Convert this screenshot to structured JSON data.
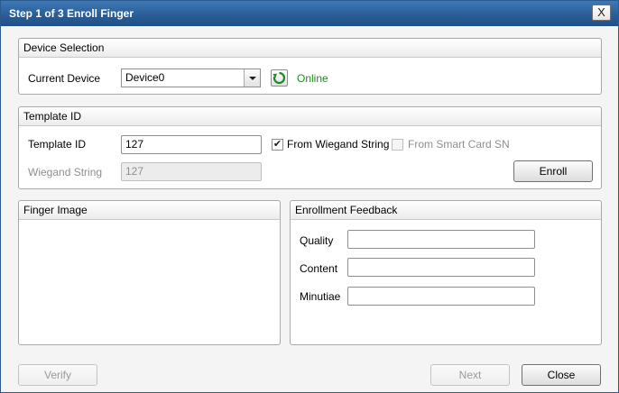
{
  "window": {
    "title": "Step 1 of 3 Enroll Finger",
    "close_glyph": "X"
  },
  "device_selection": {
    "header": "Device Selection",
    "current_device_label": "Current Device",
    "current_device_value": "Device0",
    "status": "Online"
  },
  "template_id": {
    "header": "Template ID",
    "template_id_label": "Template ID",
    "template_id_value": "127",
    "from_wiegand_label": "From Wiegand String",
    "from_wiegand_checked": true,
    "from_smart_card_label": "From Smart Card SN",
    "from_smart_card_checked": false,
    "wiegand_label": "Wiegand String",
    "wiegand_value": "127",
    "enroll_label": "Enroll"
  },
  "finger_image": {
    "header": "Finger Image"
  },
  "enrollment_feedback": {
    "header": "Enrollment Feedback",
    "quality_label": "Quality",
    "quality_value": "",
    "content_label": "Content",
    "content_value": "",
    "minutiae_label": "Minutiae",
    "minutiae_value": ""
  },
  "footer": {
    "verify_label": "Verify",
    "next_label": "Next",
    "close_label": "Close"
  },
  "colors": {
    "title_bar": "#2a5e98",
    "status_online": "#1b8e1b"
  },
  "icons": {
    "refresh": "refresh-icon",
    "check": "checkmark-icon"
  }
}
